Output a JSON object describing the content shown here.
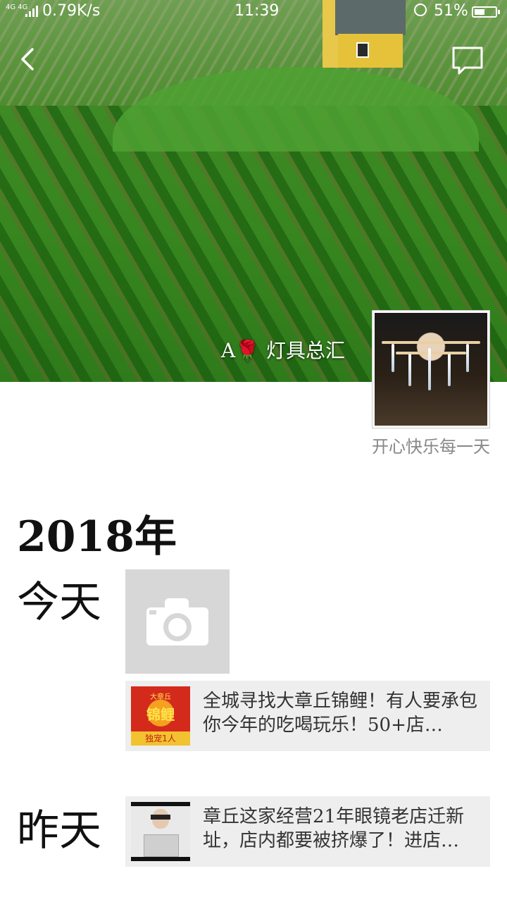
{
  "status_bar": {
    "network": "4G 4G",
    "speed": "0.79K/s",
    "time": "11:39",
    "battery_percent": "51%",
    "battery_level": 0.51
  },
  "header": {
    "back_icon": "chevron-left-icon",
    "comment_icon": "message-bubble-icon"
  },
  "profile": {
    "nickname": "A🌹 灯具总汇",
    "signature": "开心快乐每一天"
  },
  "timeline": {
    "year": "2018年",
    "entries": [
      {
        "day": "今天",
        "camera_icon": "camera-icon",
        "share": {
          "thumb_top": "大章丘",
          "thumb_title": "锦鲤",
          "thumb_banner": "独宠1人",
          "text": "全城寻找大章丘锦鲤！有人要承包你今年的吃喝玩乐！50+店…"
        }
      },
      {
        "day": "昨天",
        "share": {
          "text": "章丘这家经营21年眼镜老店迁新址，店内都要被挤爆了！进店…"
        }
      }
    ]
  }
}
